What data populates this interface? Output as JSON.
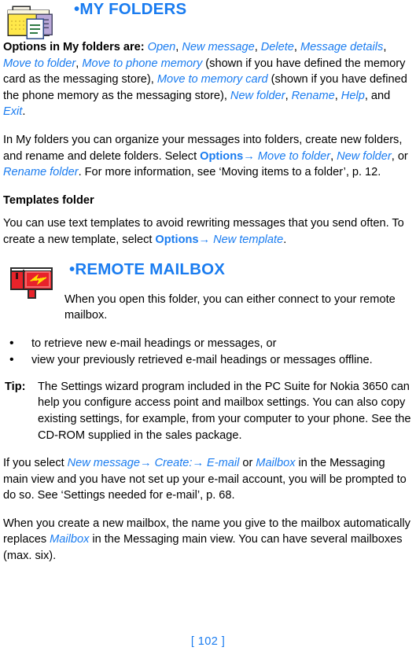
{
  "document": {
    "page_number_label": "[ 102 ]"
  },
  "sections": [
    {
      "id": "my-folders",
      "icon": "folder-with-documents-icon",
      "bullet": "•",
      "title": "MY FOLDERS"
    },
    {
      "id": "remote-mailbox",
      "icon": "red-mailbox-icon",
      "bullet": "•",
      "title": "REMOTE MAILBOX"
    }
  ],
  "my_folders": {
    "options_paragraph": {
      "lead_bold": "Options in My folders are:",
      "items": [
        "Open",
        "New message",
        "Delete",
        "Message details",
        "Move to folder",
        "Move to phone memory",
        "Move to memory card",
        "New folder",
        "Rename",
        "Help",
        "Exit"
      ],
      "note_memory_card": "(shown if you have defined the memory card as the messaging store),",
      "note_phone_memory": "(shown if you have defined the phone memory as the messaging store),",
      "conjunction": "and",
      "comma": ",",
      "period": "."
    },
    "organize_paragraph": {
      "part1": "In My folders you can organize your messages into folders, create new folders, and rename and delete folders. Select",
      "select_label": "Options",
      "arrow": "→",
      "opt1": "Move to folder",
      "opt2": "New folder",
      "opt3": "Rename folder",
      "or_word": "or",
      "part2": ". For more information, see ‘Moving items to a folder’, p. 12."
    },
    "templates": {
      "heading": "Templates folder",
      "text_part1": "You can use text templates to avoid rewriting messages that you send often. To create a new template, select",
      "select_label": "Options",
      "arrow": "→",
      "option": "New template",
      "period": "."
    }
  },
  "remote_mailbox": {
    "intro": "When you open this folder, you can either connect to your remote mailbox.",
    "bullets": [
      "to retrieve new e-mail headings or messages, or",
      "view your previously retrieved e-mail headings or messages offline."
    ],
    "tip": {
      "label": "Tip:",
      "text": "The Settings wizard program included in the PC Suite for Nokia 3650 can help you configure access point and mailbox settings. You can also copy existing settings, for example, from your computer to your phone. See the CD-ROM supplied in the sales package."
    },
    "select_paragraph": {
      "part1": "If you select",
      "opt_new_message": "New message",
      "arrow1": "→",
      "opt_create": "Create:",
      "arrow2": "→",
      "opt_email": "E-mail",
      "or_word": "or",
      "opt_mailbox": "Mailbox",
      "part2": "in the Messaging main view and you have not set up your e-mail account, you will be prompted to do so. See ‘Settings needed for e-mail’, p. 68."
    },
    "create_paragraph": {
      "part1": "When you create a new mailbox, the name you give to the mailbox automatically replaces",
      "mailbox_word": "Mailbox",
      "part2": "in the Messaging main view. You can have several mailboxes (max. six)."
    }
  },
  "colors": {
    "accent_blue": "#1a7cf0",
    "text_black": "#000000",
    "mailbox_red": "#e8232a",
    "mailbox_bolt": "#ffe000",
    "folder_yellow": "#ffe84a",
    "folder_purple": "#b9a8d8"
  }
}
